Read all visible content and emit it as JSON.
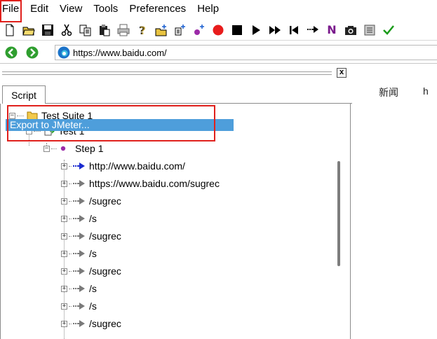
{
  "menu": {
    "file": "File",
    "edit": "Edit",
    "view": "View",
    "tools": "Tools",
    "preferences": "Preferences",
    "help": "Help"
  },
  "toolbar": {
    "icons": [
      "new-icon",
      "open-folder-icon",
      "save-icon",
      "cut-icon",
      "copy-icon",
      "paste-icon",
      "print-icon",
      "help-icon",
      "add-suite-icon",
      "add-test-icon",
      "add-step-icon",
      "record-icon",
      "stop-icon",
      "play-icon",
      "fast-forward-icon",
      "step-back-icon",
      "run-next-icon",
      "n-icon",
      "camera-icon",
      "list-icon",
      "check-icon"
    ],
    "n_label": "N"
  },
  "address": {
    "url": "https://www.baidu.com/"
  },
  "pane": {
    "close_label": "x",
    "tab_label": "Script"
  },
  "tree": {
    "suite": "Test Suite 1",
    "test": "Test 1",
    "step": "Step 1",
    "requests": [
      "http://www.baidu.com/",
      "https://www.baidu.com/sugrec",
      "/sugrec",
      "/s",
      "/sugrec",
      "/s",
      "/sugrec",
      "/s",
      "/s",
      "/sugrec"
    ]
  },
  "popup": {
    "export_label": "Export to JMeter..."
  },
  "right": {
    "news": "新闻",
    "partial": "h"
  },
  "colors": {
    "highlight": "#4e9edb",
    "callout": "#e0201c",
    "record": "#e81c1c",
    "nav_green": "#2f9e2f"
  }
}
